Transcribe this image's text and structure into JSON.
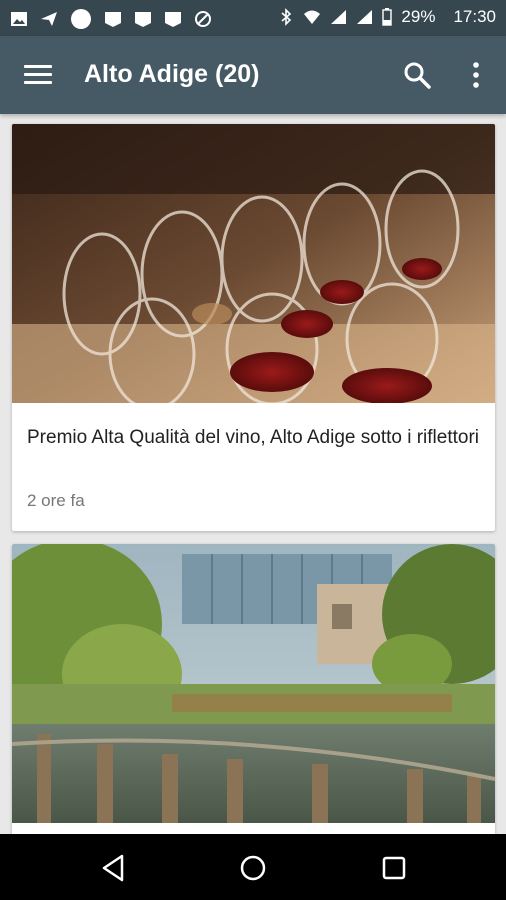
{
  "status_bar": {
    "battery": "29%",
    "time": "17:30"
  },
  "app_bar": {
    "title": "Alto Adige (20)",
    "icons": [
      "menu-icon",
      "search-icon",
      "more-vert-icon"
    ]
  },
  "articles": [
    {
      "title": "Premio Alta Qualità del vino, Alto Adige sotto i riflettori",
      "time": "2 ore fa",
      "image": "wine-glasses-photo"
    },
    {
      "title": "",
      "time": "",
      "image": "lake-building-photo"
    }
  ],
  "nav_bar": {
    "icons": [
      "back-icon",
      "home-icon",
      "recents-icon"
    ]
  },
  "colors": {
    "status_bar": "#37474f",
    "app_bar": "#455a64",
    "background": "#e8e8e8"
  }
}
